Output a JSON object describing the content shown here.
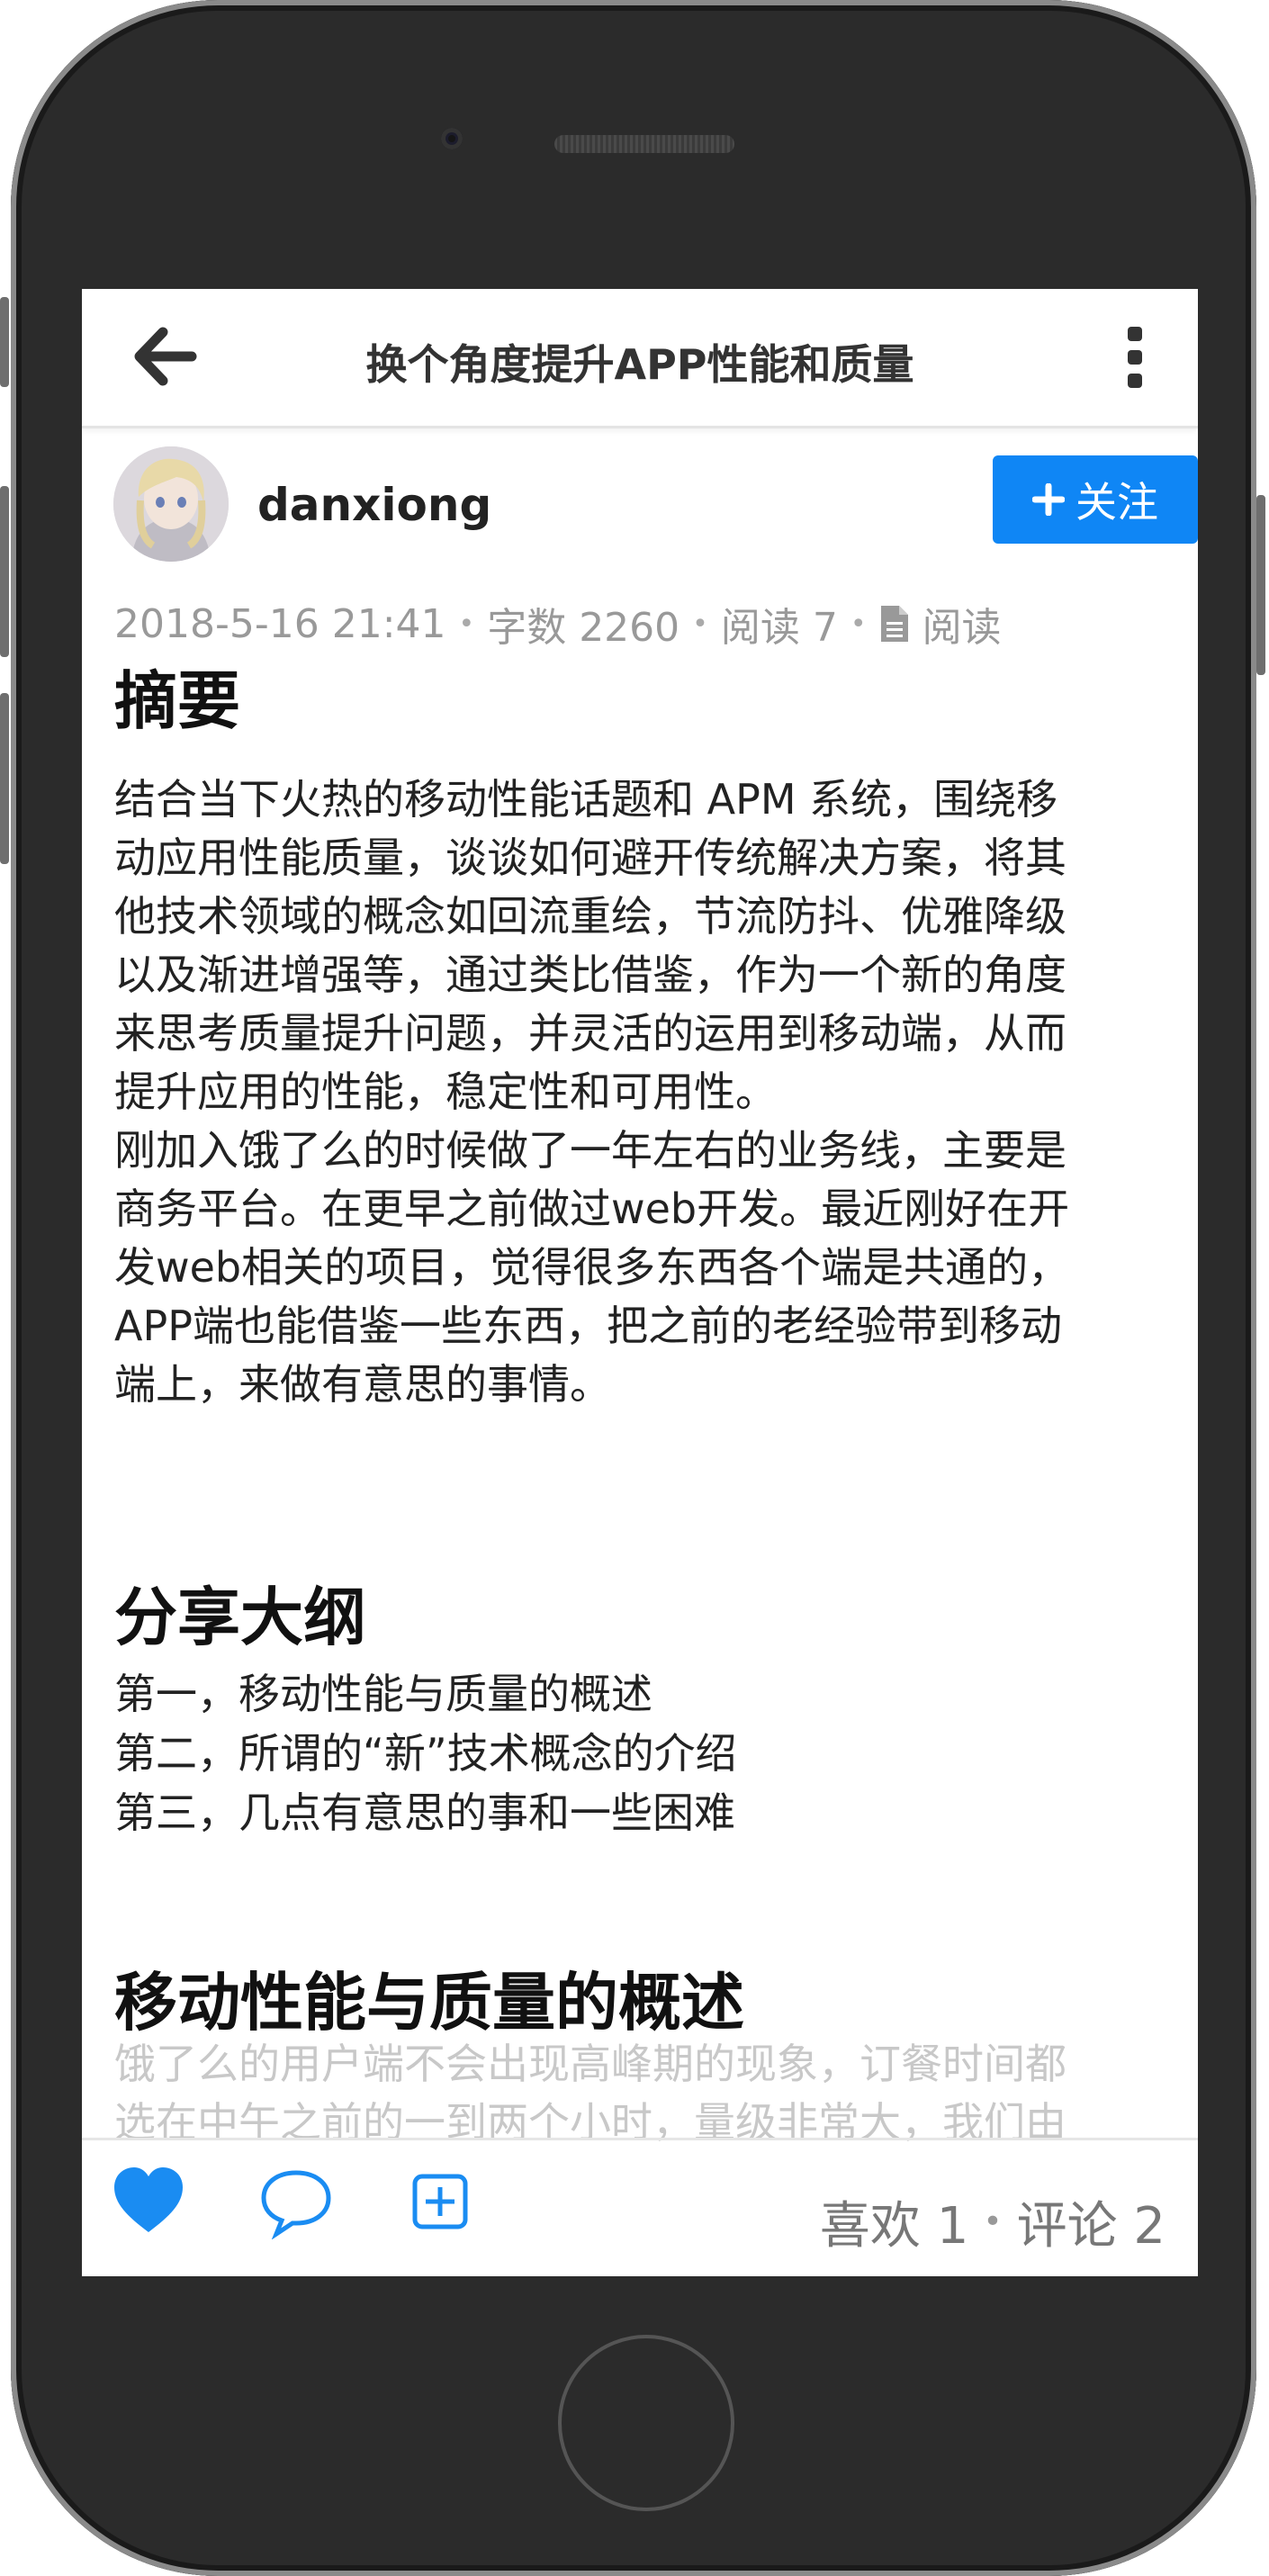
{
  "header": {
    "title": "换个角度提升APP性能和质量"
  },
  "author": {
    "name": "danxiong",
    "follow_label": "关注"
  },
  "meta": {
    "date": "2018-5-16 21:41",
    "word_count": "字数 2260",
    "reads": "阅读 7",
    "read_mode_label": "阅读"
  },
  "article": {
    "h_summary": "摘要",
    "summary_lines": [
      "结合当下火热的移动性能话题和 APM 系统，围绕移",
      "动应用性能质量，谈谈如何避开传统解决方案，将其",
      "他技术领域的概念如回流重绘，节流防抖、优雅降级",
      "以及渐进增强等，通过类比借鉴，作为一个新的角度",
      "来思考质量提升问题，并灵活的运用到移动端，从而",
      "提升应用的性能，稳定性和可用性。"
    ],
    "intro_lines": [
      "刚加入饿了么的时候做了一年左右的业务线，主要是",
      "商务平台。在更早之前做过web开发。最近刚好在开",
      "发web相关的项目，觉得很多东西各个端是共通的，",
      "APP端也能借鉴一些东西，把之前的老经验带到移动",
      "端上，来做有意思的事情。"
    ],
    "h_outline": "分享大纲",
    "outline": [
      "第一，移动性能与质量的概述",
      "第二，所谓的“新”技术概念的介绍",
      "第三，几点有意思的事和一些困难"
    ],
    "h_section": "移动性能与质量的概述",
    "section_lines": [
      "饿了么的用户端不会出现高峰期的现象，订餐时间都",
      "选在中午之前的一到两个小时，量级非常大，我们由"
    ]
  },
  "bottom_bar": {
    "likes": "喜欢 1",
    "comments": "评论 2"
  },
  "colors": {
    "accent": "#0f86f5",
    "heart": "#1a8cf2"
  },
  "icons": [
    "back-arrow-icon",
    "more-vertical-icon",
    "plus-icon",
    "document-icon",
    "heart-icon",
    "comment-icon",
    "add-box-icon"
  ]
}
